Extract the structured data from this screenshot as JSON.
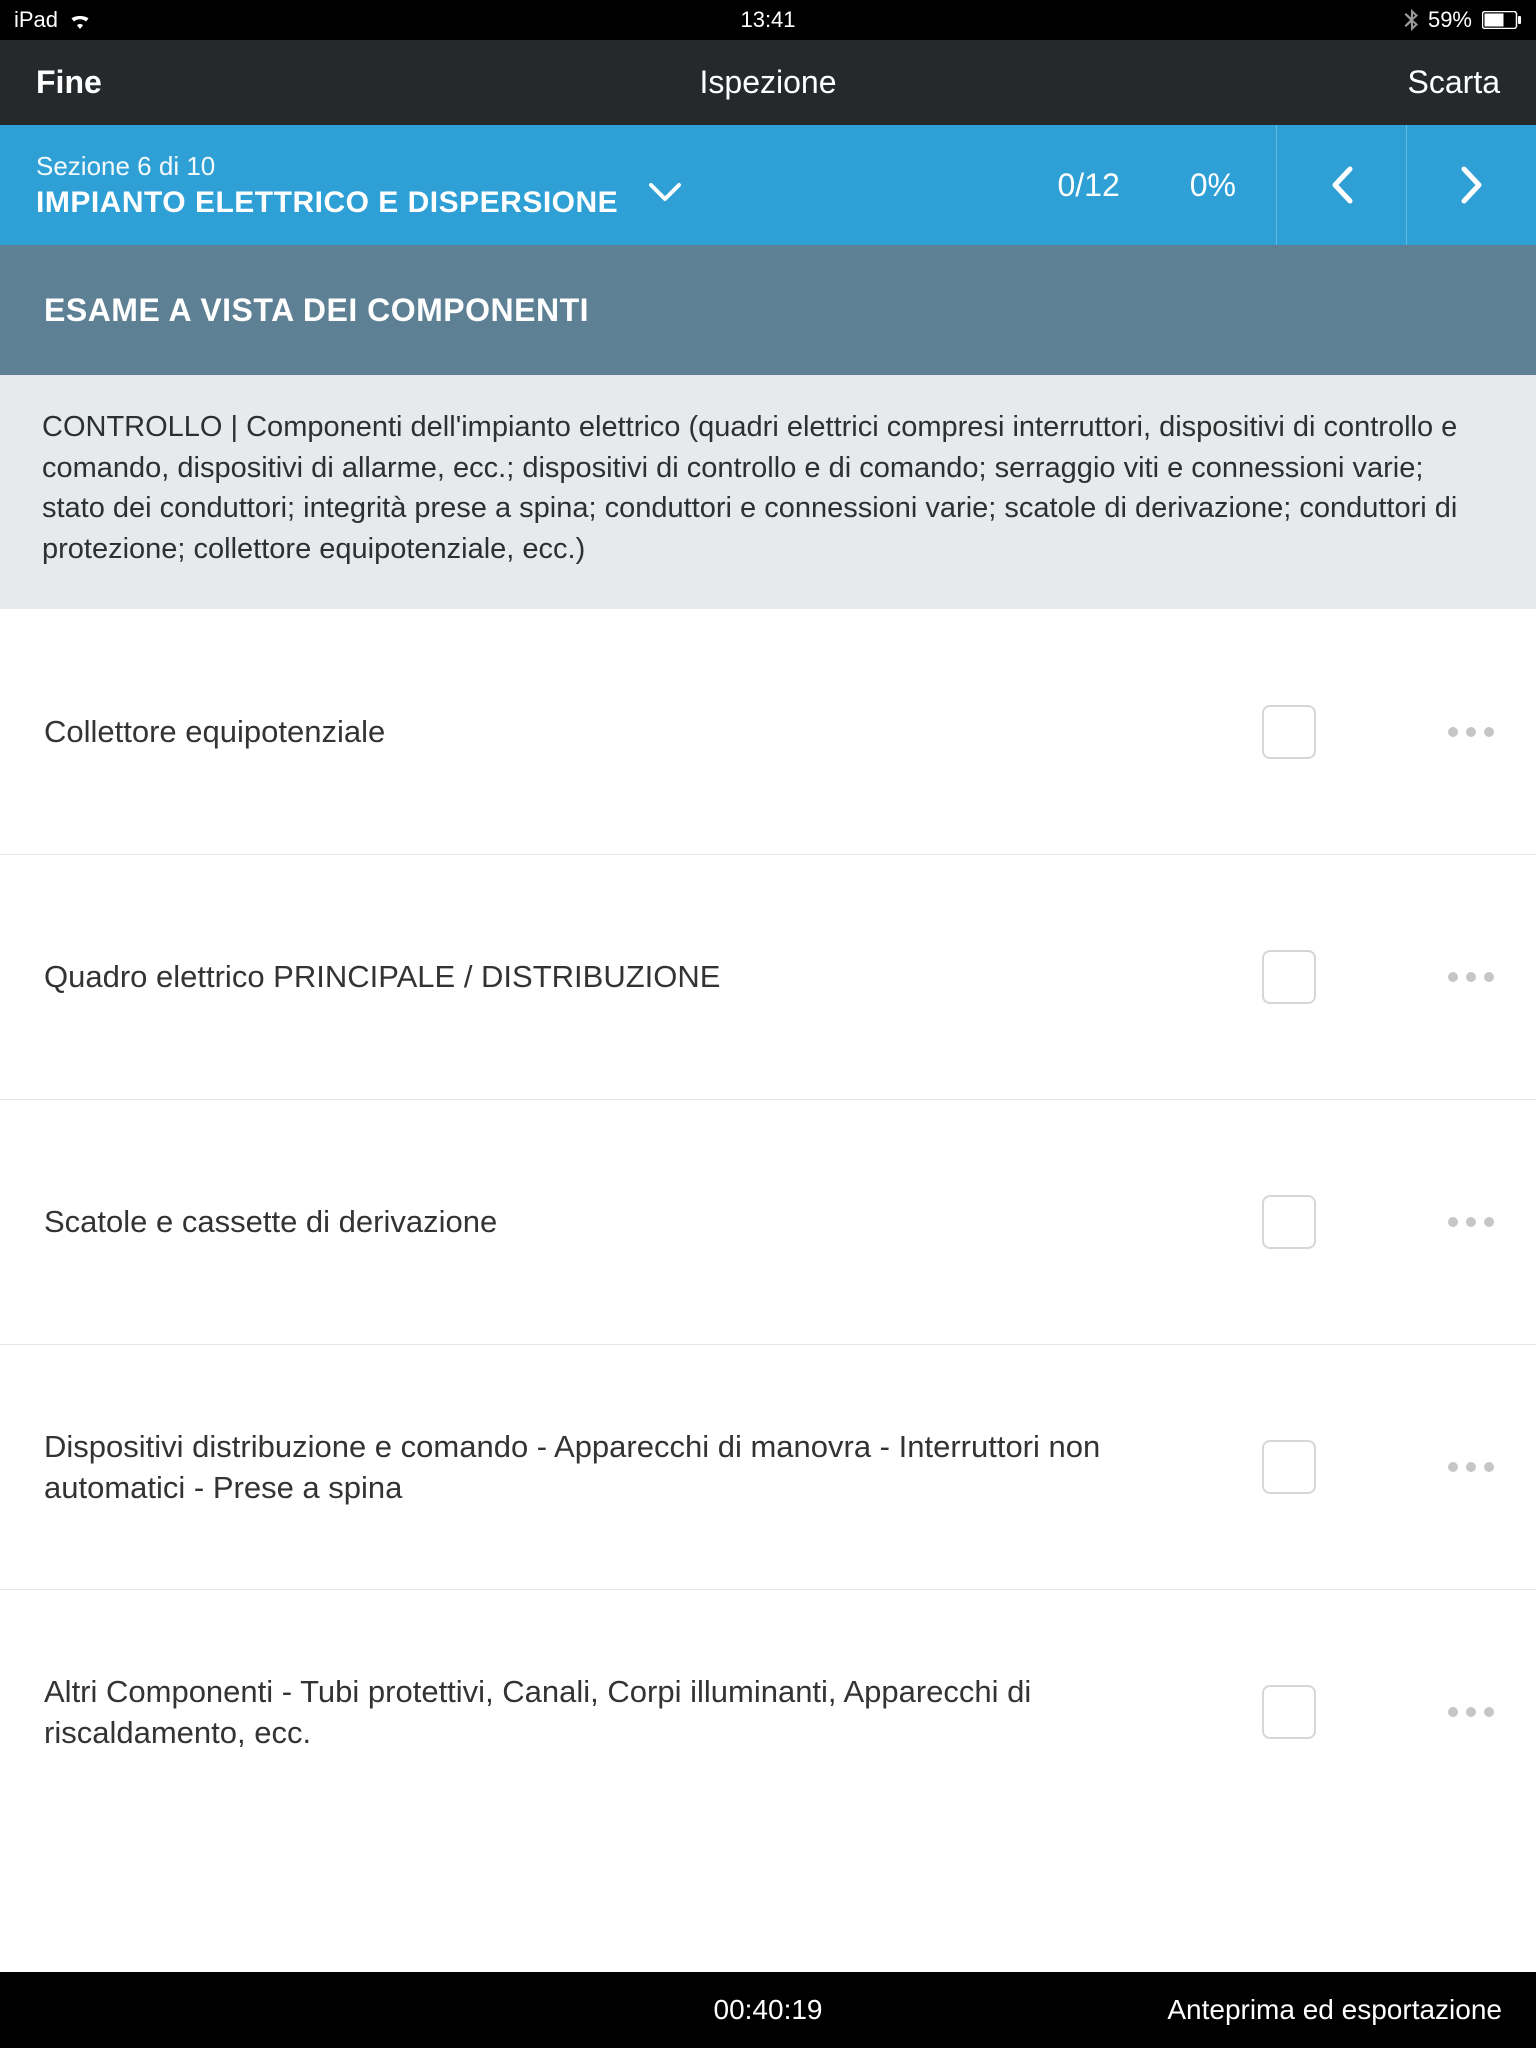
{
  "status_bar": {
    "device": "iPad",
    "time": "13:41",
    "battery_pct": "59%"
  },
  "nav": {
    "left": "Fine",
    "title": "Ispezione",
    "right": "Scarta"
  },
  "section": {
    "subtitle": "Sezione 6 di 10",
    "title": "IMPIANTO ELETTRICO E DISPERSIONE",
    "progress_count": "0/12",
    "progress_pct": "0%"
  },
  "subheader": "ESAME A VISTA DEI COMPONENTI",
  "description": "CONTROLLO | Componenti dell'impianto elettrico (quadri elettrici compresi interruttori, dispositivi di controllo e comando, dispositivi di allarme, ecc.; dispositivi di controllo e di comando; serraggio viti e connessioni varie; stato dei conduttori; integrità prese a spina; conduttori e connessioni varie; scatole di derivazione; conduttori di protezione; collettore equipotenziale, ecc.)",
  "items": [
    {
      "label": "Collettore equipotenziale"
    },
    {
      "label": "Quadro elettrico PRINCIPALE / DISTRIBUZIONE"
    },
    {
      "label": "Scatole e cassette di derivazione"
    },
    {
      "label": "Dispositivi distribuzione e comando - Apparecchi di manovra - Interruttori non automatici - Prese a spina"
    },
    {
      "label": "Altri Componenti -  Tubi protettivi, Canali, Corpi illuminanti, Apparecchi di riscaldamento, ecc."
    }
  ],
  "footer": {
    "timer": "00:40:19",
    "export": "Anteprima ed esportazione"
  }
}
